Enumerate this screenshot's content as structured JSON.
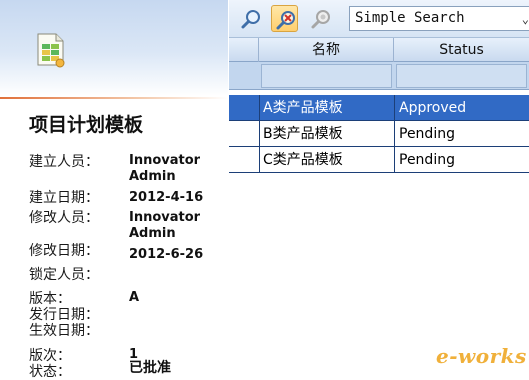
{
  "item": {
    "title": "项目计划模板",
    "properties": [
      {
        "label": "建立人员：",
        "value": "Innovator Admin"
      },
      {
        "label": "建立日期：",
        "value": "2012-4-16"
      },
      {
        "label": "修改人员：",
        "value": "Innovator Admin"
      },
      {
        "label": "修改日期：",
        "value": "2012-6-26"
      },
      {
        "label": "锁定人员：",
        "value": ""
      },
      {
        "label": "版本：",
        "value": "A"
      },
      {
        "label": "发行日期：",
        "value": ""
      },
      {
        "label": "生效日期：",
        "value": ""
      },
      {
        "label": "版次：",
        "value": "1"
      },
      {
        "label": "状态：",
        "value": "已批准"
      }
    ]
  },
  "toolbar": {
    "search_mode": "Simple Search",
    "icons": [
      "run-search-icon",
      "clear-search-icon",
      "saved-search-icon",
      "chevron-down-icon"
    ]
  },
  "grid": {
    "columns": [
      "名称",
      "Status"
    ],
    "rows": [
      {
        "name": "A类产品模板",
        "status": "Approved",
        "selected": true
      },
      {
        "name": "B类产品模板",
        "status": "Pending",
        "selected": false
      },
      {
        "name": "C类产品模板",
        "status": "Pending",
        "selected": false
      }
    ]
  },
  "watermark": {
    "text": "e-works"
  },
  "colors": {
    "selection": "#316ac5",
    "header_gradient_top": "#c6d8f0",
    "accent_rule": "#e0703a",
    "watermark": "#f0b03a"
  }
}
